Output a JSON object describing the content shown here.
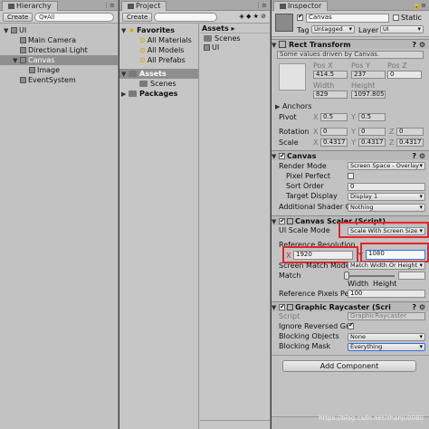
{
  "hierarchy": {
    "tab": "Hierarchy",
    "create": "Create",
    "search": "Q▾All",
    "items": [
      {
        "label": "UI",
        "indent": 0,
        "arrow": "▼",
        "icon": "unity-scene-icon"
      },
      {
        "label": "Main Camera",
        "indent": 1
      },
      {
        "label": "Directional Light",
        "indent": 1
      },
      {
        "label": "Canvas",
        "indent": 1,
        "arrow": "▼",
        "selected": true
      },
      {
        "label": "Image",
        "indent": 2
      },
      {
        "label": "EventSystem",
        "indent": 1
      }
    ]
  },
  "project": {
    "tab": "Project",
    "create": "Create",
    "search": "",
    "tree": [
      {
        "label": "Favorites",
        "bold": true,
        "arrow": "▼",
        "icon": "star"
      },
      {
        "label": "All Materials",
        "indent": 1,
        "icon": "search"
      },
      {
        "label": "All Models",
        "indent": 1,
        "icon": "search"
      },
      {
        "label": "All Prefabs",
        "indent": 1,
        "icon": "search"
      },
      {
        "label": "Assets",
        "bold": true,
        "arrow": "▼",
        "icon": "folder",
        "selected": true
      },
      {
        "label": "Scenes",
        "indent": 1,
        "icon": "folder"
      },
      {
        "label": "Packages",
        "bold": true,
        "arrow": "▶",
        "icon": "folder"
      }
    ],
    "breadcrumb": "Assets ▸",
    "assets": [
      "Scenes",
      "UI"
    ]
  },
  "inspector": {
    "tab": "Inspector",
    "name": "Canvas",
    "static": "Static",
    "tag_label": "Tag",
    "tag_value": "Untagged",
    "layer_label": "Layer",
    "layer_value": "UI",
    "rect_transform": {
      "title": "Rect Transform",
      "note": "Some values driven by Canvas.",
      "pos_x_label": "Pos X",
      "pos_y_label": "Pos Y",
      "pos_z_label": "Pos Z",
      "pos_x": "414.5",
      "pos_y": "237",
      "pos_z": "0",
      "width_label": "Width",
      "height_label": "Height",
      "width": "829",
      "height": "1097.805",
      "anchors": "Anchors",
      "pivot": "Pivot",
      "pivot_x": "0.5",
      "pivot_y": "0.5",
      "rotation": "Rotation",
      "rot_x": "0",
      "rot_y": "0",
      "rot_z": "0",
      "scale": "Scale",
      "scale_x": "0.4317",
      "scale_y": "0.4317",
      "scale_z": "0.4317"
    },
    "canvas": {
      "title": "Canvas",
      "render_mode_label": "Render Mode",
      "render_mode": "Screen Space - Overlay",
      "pixel_perfect": "Pixel Perfect",
      "sort_order_label": "Sort Order",
      "sort_order": "0",
      "target_display_label": "Target Display",
      "target_display": "Display 1",
      "shader_label": "Additional Shader Ch",
      "shader_value": "Nothing"
    },
    "scaler": {
      "title": "Canvas Scaler (Script)",
      "ui_scale_label": "UI Scale Mode",
      "ui_scale": "Scale With Screen Size",
      "ref_res_label": "Reference Resolution",
      "x_label": "X",
      "x": "1920",
      "y_label": "Y",
      "y": "1080",
      "match_mode_label": "Screen Match Mode",
      "match_mode": "Match Width Or Height",
      "match_label": "Match",
      "width": "Width",
      "height": "Height",
      "ref_ppu_label": "Reference Pixels Per",
      "ref_ppu": "100"
    },
    "raycaster": {
      "title": "Graphic Raycaster (Scri",
      "script_label": "Script",
      "script_value": "GraphicRaycaster",
      "ignore_label": "Ignore Reversed Gra",
      "blocking_objects_label": "Blocking Objects",
      "blocking_objects": "None",
      "blocking_mask_label": "Blocking Mask",
      "blocking_mask": "Everything"
    },
    "add_component": "Add Component"
  },
  "watermark": "https://blog.csdn.net/zhanju0080",
  "colors": {
    "highlight": "#e8232a",
    "field_focus": "#3a6fd8",
    "selection": "#8f8f8f"
  }
}
